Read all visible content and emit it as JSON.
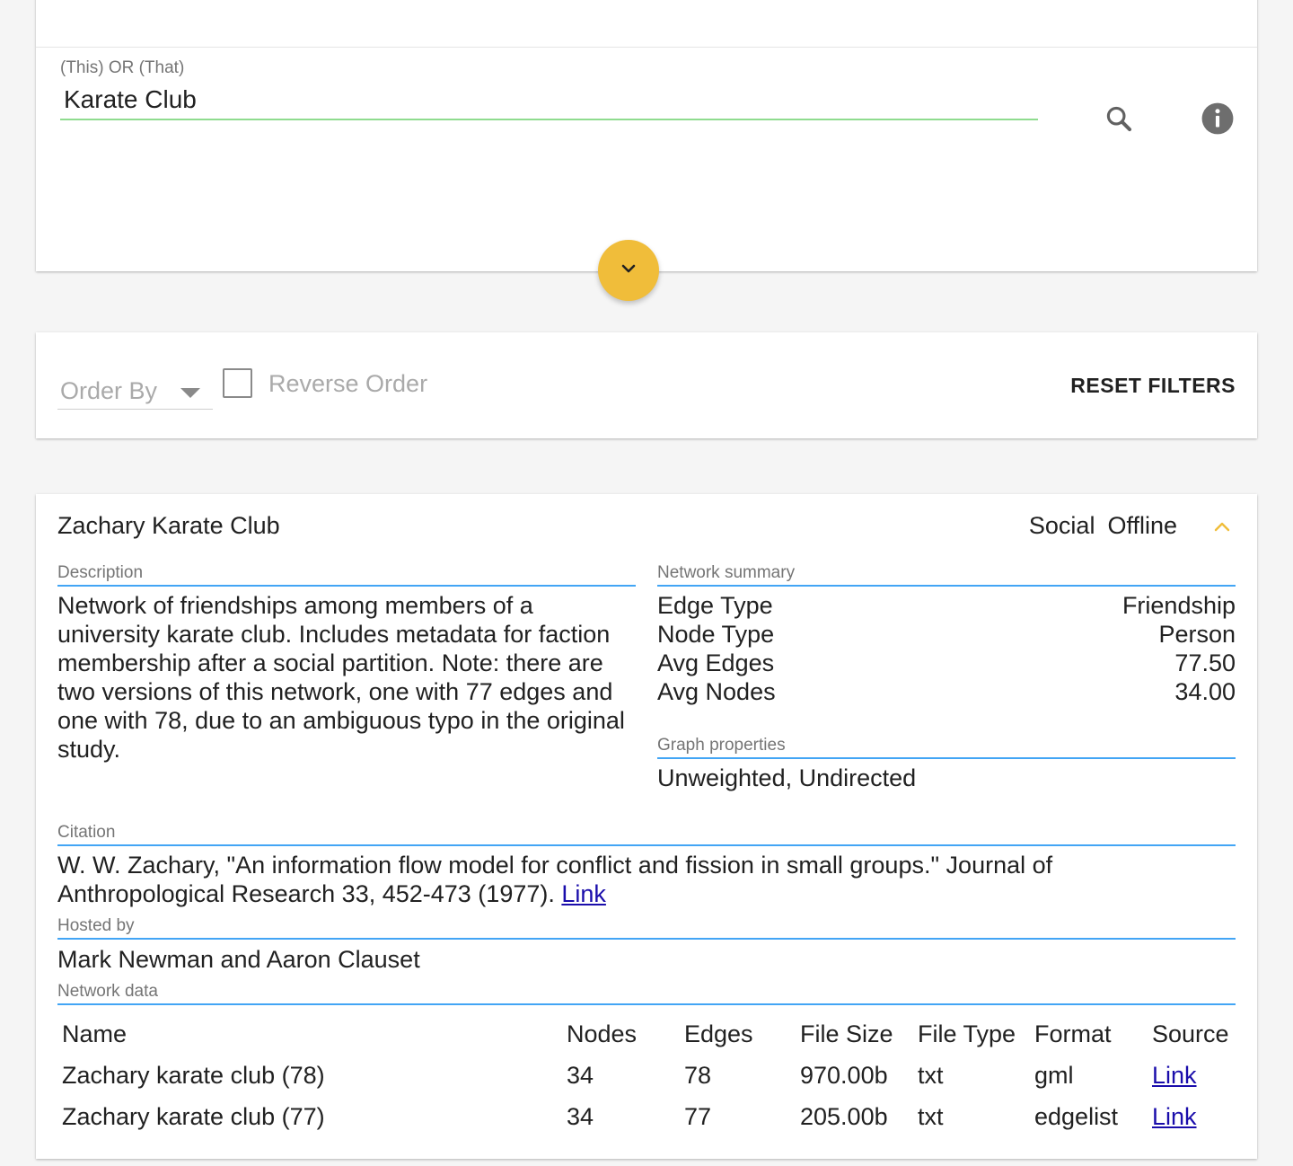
{
  "search": {
    "label": "(This) OR (That)",
    "value": "Karate Club"
  },
  "filters": {
    "order_by_placeholder": "Order By",
    "reverse_order_label": "Reverse Order",
    "reverse_order_checked": false,
    "reset_label": "RESET FILTERS"
  },
  "result": {
    "title": "Zachary Karate Club",
    "tags": [
      "Social",
      "Offline"
    ],
    "description_label": "Description",
    "description": "Network of friendships among members of a university karate club. Includes metadata for faction membership after a social partition. Note: there are two versions of this network, one with 77 edges and one with 78, due to an ambiguous typo in the original study.",
    "summary_label": "Network summary",
    "summary": [
      {
        "key": "Edge Type",
        "value": "Friendship"
      },
      {
        "key": "Node Type",
        "value": "Person"
      },
      {
        "key": "Avg Edges",
        "value": "77.50"
      },
      {
        "key": "Avg Nodes",
        "value": "34.00"
      }
    ],
    "graph_properties_label": "Graph properties",
    "graph_properties": "Unweighted, Undirected",
    "citation_label": "Citation",
    "citation": "W. W. Zachary, \"An information flow model for conflict and fission in small groups.\" Journal of Anthropological Research 33, 452-473 (1977).",
    "citation_link": "Link",
    "hosted_by_label": "Hosted by",
    "hosted_by": "Mark Newman and Aaron Clauset",
    "network_data_label": "Network data",
    "table": {
      "headers": [
        "Name",
        "Nodes",
        "Edges",
        "File Size",
        "File Type",
        "Format",
        "Source"
      ],
      "rows": [
        {
          "name": "Zachary karate club (78)",
          "nodes": "34",
          "edges": "78",
          "size": "970.00b",
          "type": "txt",
          "format": "gml",
          "source": "Link"
        },
        {
          "name": "Zachary karate club (77)",
          "nodes": "34",
          "edges": "77",
          "size": "205.00b",
          "type": "txt",
          "format": "edgelist",
          "source": "Link"
        }
      ]
    }
  },
  "colors": {
    "accent": "#f0bd3a",
    "input_underline": "#8fdc8f",
    "section_underline": "#42a5f5",
    "link": "#1a0dab"
  },
  "icons": [
    "search-icon",
    "info-icon",
    "chevron-down-icon",
    "chevron-up-icon"
  ]
}
